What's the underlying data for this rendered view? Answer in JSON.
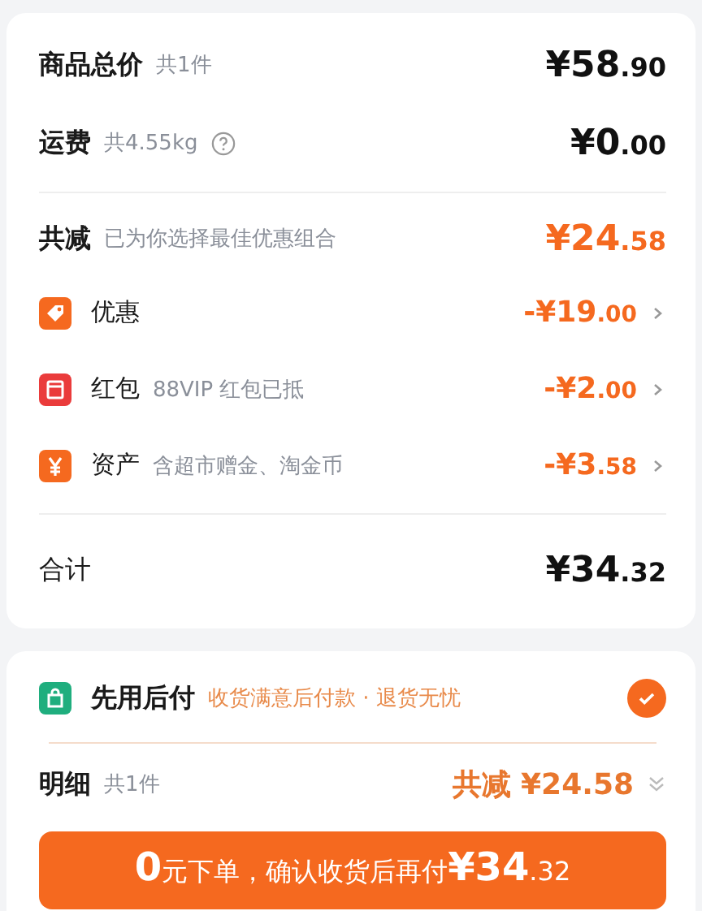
{
  "summary": {
    "rows": [
      {
        "label": "商品总价",
        "note": "共1件",
        "amount": "¥58.90",
        "help": false
      },
      {
        "label": "运费",
        "note": "共4.55kg",
        "amount": "¥0.00",
        "help": true
      }
    ],
    "discount_total": {
      "label": "共减",
      "note": "已为你选择最佳优惠组合",
      "amount": "¥24.58"
    },
    "discounts": [
      {
        "kind": "tag",
        "label": "优惠",
        "amount": "-¥19.00"
      },
      {
        "kind": "packet",
        "label": "红包",
        "note": "88VIP 红包已抵",
        "amount": "-¥2.00"
      },
      {
        "kind": "yen",
        "label": "资产",
        "note": "含超市赠金、淘金币",
        "amount": "-¥3.58"
      }
    ],
    "total": {
      "label": "合计",
      "amount": "¥34.32"
    }
  },
  "payment": {
    "label": "先用后付",
    "note": "收货满意后付款 · 退货无忧",
    "checked": true
  },
  "detail": {
    "label": "明细",
    "note": "共1件",
    "saving": "共减 ¥24.58",
    "expanded": false
  },
  "submit": {
    "lead": "0",
    "text": "元下单，确认收货后再付",
    "amount": "¥34.32"
  }
}
